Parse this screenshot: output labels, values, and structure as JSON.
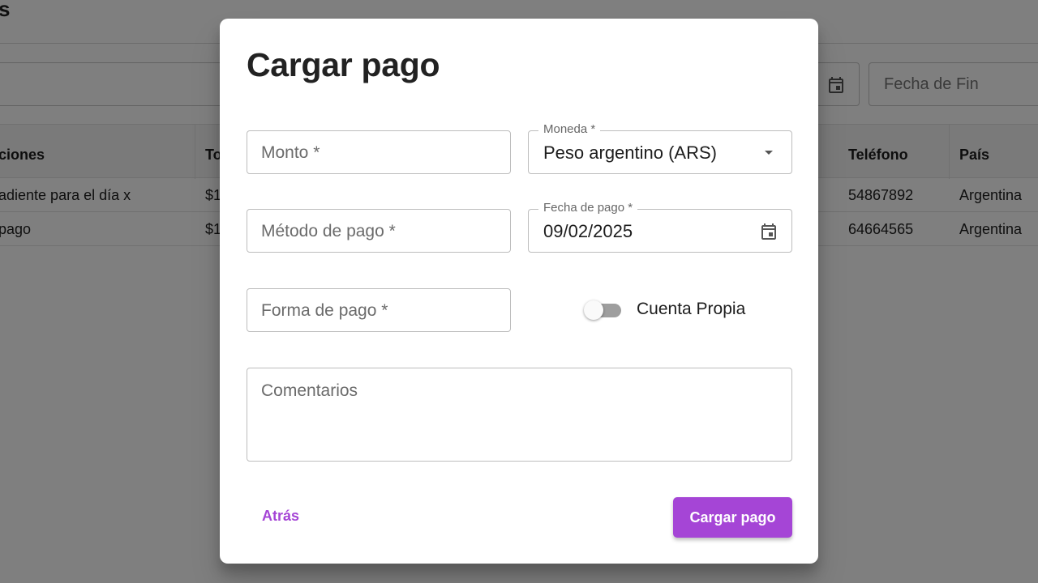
{
  "background": {
    "page_title_fragment": "s",
    "date_end_placeholder": "Fecha de Fin",
    "table": {
      "headers": [
        "ciones",
        "To",
        "Teléfono",
        "País"
      ],
      "rows": [
        [
          "adiente para el día x",
          "$1",
          "54867892",
          "Argentina"
        ],
        [
          "pago",
          "$1",
          "64664565",
          "Argentina"
        ]
      ]
    }
  },
  "dialog": {
    "title": "Cargar pago",
    "monto": {
      "placeholder": "Monto *"
    },
    "moneda": {
      "label": "Moneda *",
      "value": "Peso argentino (ARS)"
    },
    "metodo": {
      "placeholder": "Método de pago *"
    },
    "fecha": {
      "label": "Fecha de pago *",
      "value": "09/02/2025"
    },
    "forma": {
      "placeholder": "Forma de pago *"
    },
    "cuenta_propia": {
      "label": "Cuenta Propia",
      "checked": false
    },
    "comentarios": {
      "placeholder": "Comentarios"
    },
    "back_label": "Atrás",
    "submit_label": "Cargar pago"
  },
  "colors": {
    "accent": "#a545d6",
    "overlay": "rgba(0,0,0,0.5)"
  },
  "icons": [
    "calendar-icon",
    "chevron-down-icon"
  ]
}
